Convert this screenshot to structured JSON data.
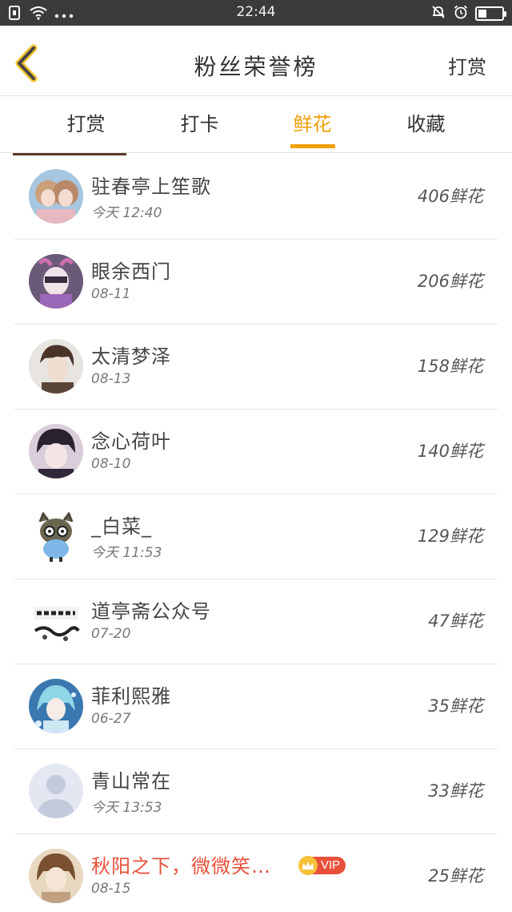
{
  "status_bar": {
    "time": "22:44",
    "battery_level": 0.35
  },
  "header": {
    "title": "粉丝荣誉榜",
    "action_label": "打赏"
  },
  "tabs": [
    {
      "label": "打赏",
      "active": false
    },
    {
      "label": "打卡",
      "active": false
    },
    {
      "label": "鲜花",
      "active": true
    },
    {
      "label": "收藏",
      "active": false
    }
  ],
  "colors": {
    "accent": "#f0a00a",
    "vip": "#e8503a"
  },
  "list": [
    {
      "name": "驻春亭上笙歌",
      "date": "今天 12:40",
      "amount": "406鲜花",
      "vip": false
    },
    {
      "name": "眼余西门",
      "date": "08-11",
      "amount": "206鲜花",
      "vip": false
    },
    {
      "name": "太清梦泽",
      "date": "08-13",
      "amount": "158鲜花",
      "vip": false
    },
    {
      "name": "念心荷叶",
      "date": "08-10",
      "amount": "140鲜花",
      "vip": false
    },
    {
      "name": "_白菜_",
      "date": "今天 11:53",
      "amount": "129鲜花",
      "vip": false
    },
    {
      "name": "道亭斋公众号",
      "date": "07-20",
      "amount": "47鲜花",
      "vip": false
    },
    {
      "name": "菲利熙雅",
      "date": "06-27",
      "amount": "35鲜花",
      "vip": false
    },
    {
      "name": "青山常在",
      "date": "今天 13:53",
      "amount": "33鲜花",
      "vip": false
    },
    {
      "name": "秋阳之下，微微笑…",
      "date": "08-15",
      "amount": "25鲜花",
      "vip": true,
      "vip_label": "VIP"
    }
  ]
}
